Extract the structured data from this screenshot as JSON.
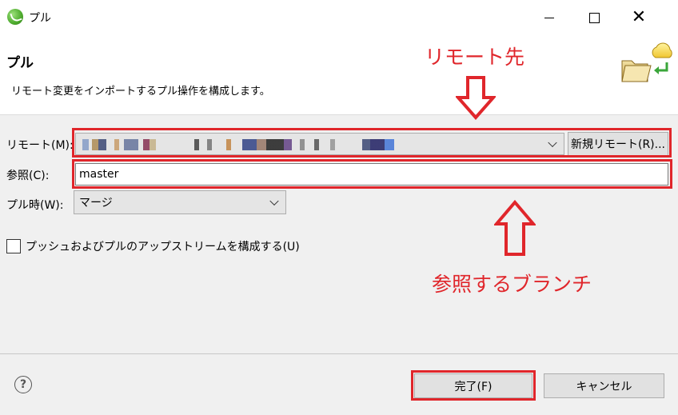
{
  "window": {
    "title": "プル",
    "icon": "eclipse-egit-icon"
  },
  "header": {
    "title": "プル",
    "description": "リモート変更をインポートするプル操作を構成します。",
    "banner_icon": "folder-cloud-pull-icon"
  },
  "annotations": {
    "remote_label": "リモート先",
    "branch_label": "参照するブランチ",
    "color": "#e0262b"
  },
  "form": {
    "remote_label": "リモート(M):",
    "new_remote_label": "新規リモート(R)...",
    "ref_label": "参照(C):",
    "ref_value": "master",
    "pull_mode_label": "プル時(W):",
    "pull_mode_value": "マージ",
    "upstream_checkbox_label": "プッシュおよびプルのアップストリームを構成する(U)"
  },
  "footer": {
    "help_glyph": "?",
    "finish_label": "完了(F)",
    "cancel_label": "キャンセル"
  }
}
